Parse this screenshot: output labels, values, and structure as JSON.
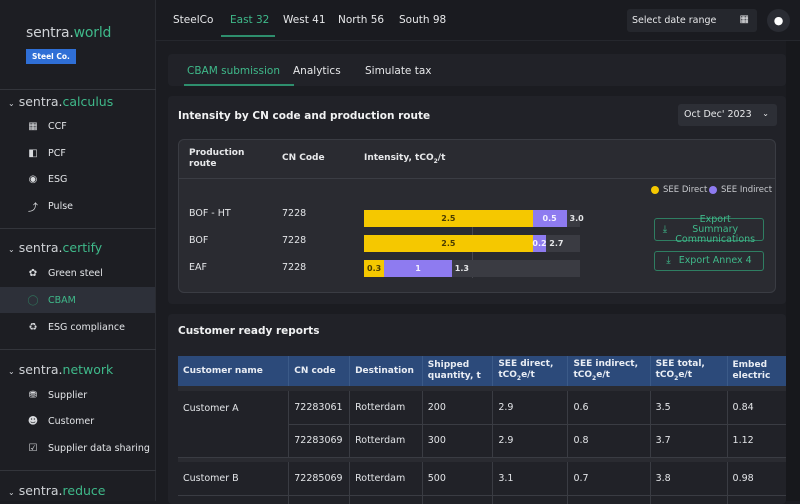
{
  "sidebar": {
    "brand": {
      "prefix": "sentra.",
      "suffix": "world"
    },
    "org_badge": "Steel Co.",
    "sections": [
      {
        "prefix": "sentra.",
        "suffix": "calculus",
        "items": [
          {
            "label": "CCF",
            "icon": "building-icon"
          },
          {
            "label": "PCF",
            "icon": "steel-bar-icon"
          },
          {
            "label": "ESG",
            "icon": "globe-icon"
          },
          {
            "label": "Pulse",
            "icon": "lightning-icon"
          }
        ]
      },
      {
        "prefix": "sentra.",
        "suffix": "certify",
        "items": [
          {
            "label": "Green steel",
            "icon": "leaf-icon"
          },
          {
            "label": "CBAM",
            "icon": "circle-icon",
            "active": true
          },
          {
            "label": "ESG compliance",
            "icon": "recycle-icon"
          }
        ]
      },
      {
        "prefix": "sentra.",
        "suffix": "network",
        "items": [
          {
            "label": "Supplier",
            "icon": "truck-icon"
          },
          {
            "label": "Customer",
            "icon": "user-icon"
          },
          {
            "label": "Supplier data sharing",
            "icon": "clipboard-icon"
          }
        ]
      },
      {
        "prefix": "sentra.",
        "suffix": "reduce",
        "items": []
      }
    ]
  },
  "topbar": {
    "tabs": [
      "SteelCo",
      "East 32",
      "West 41",
      "North 56",
      "South 98"
    ],
    "active_tab": "East 32",
    "date_range_placeholder": "Select date range"
  },
  "subtabs": {
    "items": [
      "CBAM submission",
      "Analytics",
      "Simulate tax"
    ],
    "active": "CBAM submission"
  },
  "intensity": {
    "title": "Intensity by CN code and production route",
    "period": "Oct Dec' 2023",
    "headers": {
      "route": "Production route",
      "cn": "CN Code",
      "intensity": "Intensity, tCO",
      "intensity_sub": "2",
      "intensity_unit": "/t"
    },
    "legend": [
      {
        "label": "SEE Direct",
        "color": "#f5c800"
      },
      {
        "label": "SEE Indirect",
        "color": "#8e7bf0"
      }
    ],
    "rows": [
      {
        "route": "BOF - HT",
        "cn": "7228",
        "direct": 2.5,
        "indirect": 0.5,
        "total": "3.0"
      },
      {
        "route": "BOF",
        "cn": "7228",
        "direct": 2.5,
        "indirect": 0.2,
        "total": "2.7"
      },
      {
        "route": "EAF",
        "cn": "7228",
        "direct": 0.3,
        "indirect": 1,
        "total": "1.3"
      }
    ],
    "buttons": {
      "export_summary": "Export Summary Communications",
      "export_annex": "Export Annex 4"
    }
  },
  "reports": {
    "title": "Customer ready reports",
    "columns": [
      "Customer name",
      "CN code",
      "Destination",
      "Shipped quantity, t",
      "SEE direct, tCO2e/t",
      "SEE indirect, tCO2e/t",
      "SEE total, tCO2e/t",
      "Embedded electricity"
    ],
    "rows": [
      {
        "customer": "Customer A",
        "cn": "72283061",
        "dest": "Rotterdam",
        "qty": "200",
        "direct": "2.9",
        "indirect": "0.6",
        "total": "3.5",
        "embed": "0.84"
      },
      {
        "customer": "",
        "cn": "72283069",
        "dest": "Rotterdam",
        "qty": "300",
        "direct": "2.9",
        "indirect": "0.8",
        "total": "3.7",
        "embed": "1.12"
      },
      {
        "customer": "Customer B",
        "cn": "72285069",
        "dest": "Rotterdam",
        "qty": "500",
        "direct": "3.1",
        "indirect": "0.7",
        "total": "3.8",
        "embed": "0.98"
      }
    ]
  }
}
